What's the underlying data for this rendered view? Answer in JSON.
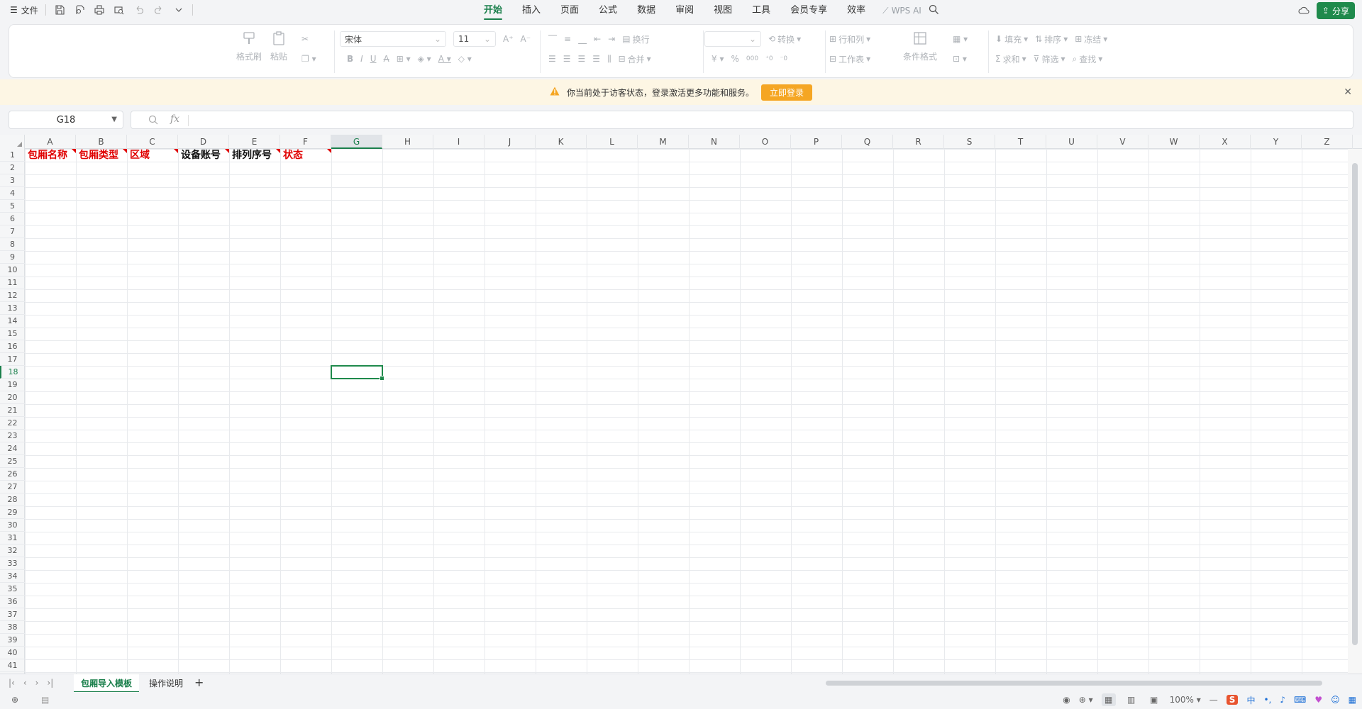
{
  "topbar": {
    "file_menu": "文件",
    "tabs": [
      "开始",
      "插入",
      "页面",
      "公式",
      "数据",
      "审阅",
      "视图",
      "工具",
      "会员专享",
      "效率"
    ],
    "active_tab": "开始",
    "wps_ai": "WPS AI",
    "share": "分享"
  },
  "ribbon": {
    "format_painter": "格式刷",
    "paste": "粘贴",
    "font_name": "宋体",
    "font_size": "11",
    "wrap": "换行",
    "merge": "合并",
    "convert": "转换",
    "row_col": "行和列",
    "worksheet": "工作表",
    "cond_format": "条件格式",
    "fill": "填充",
    "sort": "排序",
    "freeze": "冻结",
    "sum": "求和",
    "filter": "筛选",
    "find": "查找",
    "bold": "B",
    "italic": "I",
    "underline": "U",
    "strike": "A",
    "percent": "%",
    "thousands": "000"
  },
  "notice": {
    "text": "你当前处于访客状态，登录激活更多功能和服务。",
    "button": "立即登录"
  },
  "formula_bar": {
    "name_box": "G18",
    "fx": "fx",
    "value": ""
  },
  "sheet": {
    "columns": [
      "A",
      "B",
      "C",
      "D",
      "E",
      "F",
      "G",
      "H",
      "I",
      "J",
      "K",
      "L",
      "M",
      "N",
      "O",
      "P",
      "Q",
      "R",
      "S",
      "T",
      "U",
      "V",
      "W",
      "X",
      "Y",
      "Z"
    ],
    "selected_column": "G",
    "selected_row": 18,
    "rows": 41,
    "header_cells": [
      {
        "text": "包厢名称",
        "color": "#e00000"
      },
      {
        "text": "包厢类型",
        "color": "#e00000"
      },
      {
        "text": "区域",
        "color": "#e00000"
      },
      {
        "text": "设备账号",
        "color": "#111111"
      },
      {
        "text": "排列序号",
        "color": "#111111"
      },
      {
        "text": "状态",
        "color": "#e00000"
      }
    ]
  },
  "sheet_tabs": [
    "包厢导入模板",
    "操作说明"
  ],
  "active_sheet": "包厢导入模板",
  "status": {
    "zoom": "100%"
  },
  "colors": {
    "accent": "#1f8a4c",
    "notice_bg": "#fdf6e4",
    "login_btn": "#f5a623",
    "required_red": "#e00000"
  }
}
